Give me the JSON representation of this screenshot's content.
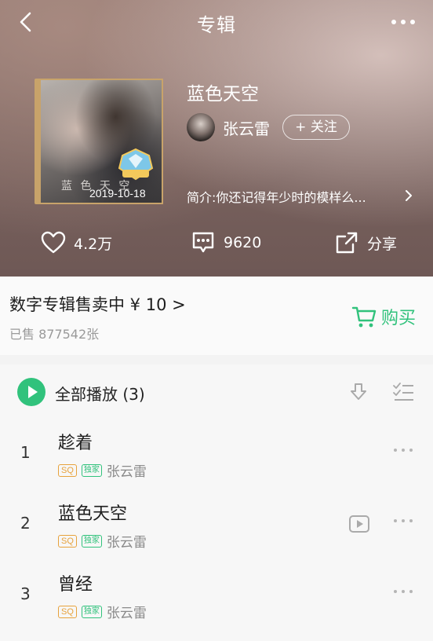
{
  "header": {
    "title": "专辑"
  },
  "album": {
    "title": "蓝色天空",
    "cover_text": "蓝 色 天 空",
    "release_date": "2019-10-18",
    "artist": "张云雷",
    "follow_label": "+ 关注",
    "intro": "简介:你还记得年少时的模样么...",
    "likes": "4.2万",
    "comments": "9620",
    "share_label": "分享"
  },
  "purchase": {
    "title": "数字专辑售卖中 ¥ 10 >",
    "sold": "已售 877542张",
    "buy_label": "购买"
  },
  "tracklist": {
    "play_all_label": "全部播放 (3)",
    "tracks": [
      {
        "num": "1",
        "title": "趁着",
        "quality": "SQ",
        "exclusive": "独家",
        "artist": "张云雷",
        "has_mv": false
      },
      {
        "num": "2",
        "title": "蓝色天空",
        "quality": "SQ",
        "exclusive": "独家",
        "artist": "张云雷",
        "has_mv": true
      },
      {
        "num": "3",
        "title": "曾经",
        "quality": "SQ",
        "exclusive": "独家",
        "artist": "张云雷",
        "has_mv": false
      }
    ]
  },
  "colors": {
    "accent": "#31c27c",
    "sq_tag": "#e7a23c",
    "hero_bg": "#7d6662"
  },
  "icons": [
    "back-icon",
    "more-icon",
    "heart-icon",
    "comment-icon",
    "share-icon",
    "cart-icon",
    "play-icon",
    "download-icon",
    "multi-select-icon",
    "mv-icon"
  ]
}
